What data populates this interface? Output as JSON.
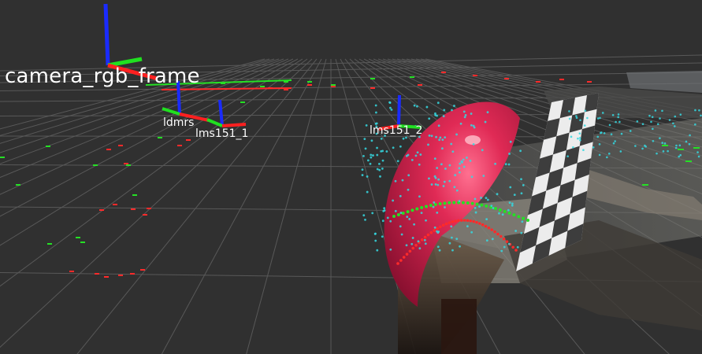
{
  "viewport": {
    "background_color": "#303030",
    "grid_color": "#7a7a7a"
  },
  "frames": {
    "camera_rgb_frame": "camera_rgb_frame",
    "ldmrs": "ldmrs",
    "lms151_1": "lms151_1",
    "lms151_2": "lms151_2"
  },
  "colors": {
    "axis_x": "#ff2020",
    "axis_y": "#20e020",
    "axis_z": "#1a2bff",
    "laser_red": "#ff2a2a",
    "laser_green": "#25e025",
    "laser_cyan": "#35d8e0",
    "sphere": "#d8204a",
    "calibration_board_light": "#f2f2f2",
    "calibration_board_dark": "#202020"
  }
}
